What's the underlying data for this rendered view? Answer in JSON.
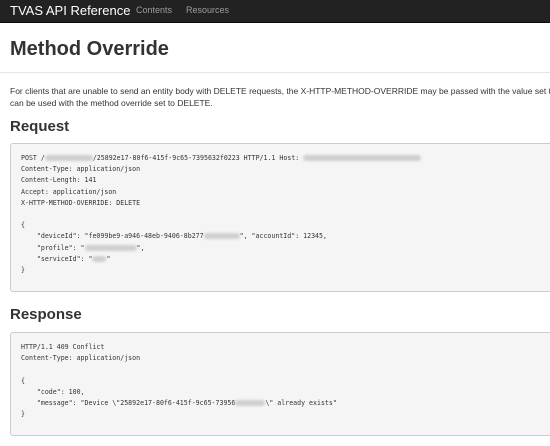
{
  "navbar": {
    "brand": "TVAS API Reference",
    "links": [
      "Contents",
      "Resources"
    ]
  },
  "page": {
    "title": "Method Override",
    "intro_lines": [
      "For clients that are unable to send an entity body with DELETE requests, the X-HTTP-METHOD-OVERRIDE may be passed with the value set to the ve",
      "can be used with the method override set to DELETE."
    ]
  },
  "request": {
    "heading": "Request",
    "lines": [
      {
        "parts": [
          {
            "t": "POST /"
          },
          {
            "blur": 48
          },
          {
            "t": "/25892e17-80f6-415f-9c65-7395632f0223 HTTP/1.1 Host: "
          },
          {
            "blur": 118
          }
        ]
      },
      {
        "parts": [
          {
            "t": "Content-Type: application/json"
          }
        ]
      },
      {
        "parts": [
          {
            "t": "Content-Length: 141"
          }
        ]
      },
      {
        "parts": [
          {
            "t": "Accept: application/json"
          }
        ]
      },
      {
        "parts": [
          {
            "t": "X-HTTP-METHOD-OVERRIDE: DELETE"
          }
        ]
      },
      {
        "parts": [
          {
            "t": ""
          }
        ]
      },
      {
        "parts": [
          {
            "t": "{"
          }
        ]
      },
      {
        "parts": [
          {
            "t": "    \"deviceId\": \"fe099be9-a946-48eb-9406-8b277"
          },
          {
            "blur": 36
          },
          {
            "t": "\", \"accountId\": 12345,"
          }
        ]
      },
      {
        "parts": [
          {
            "t": "    \"profile\": \""
          },
          {
            "blur": 52
          },
          {
            "t": "\","
          }
        ]
      },
      {
        "parts": [
          {
            "t": "    \"serviceId\": \""
          },
          {
            "blur": 14
          },
          {
            "t": "\""
          }
        ]
      },
      {
        "parts": [
          {
            "t": "}"
          }
        ]
      }
    ]
  },
  "response": {
    "heading": "Response",
    "lines": [
      {
        "parts": [
          {
            "t": "HTTP/1.1 409 Conflict"
          }
        ]
      },
      {
        "parts": [
          {
            "t": "Content-Type: application/json"
          }
        ]
      },
      {
        "parts": [
          {
            "t": ""
          }
        ]
      },
      {
        "parts": [
          {
            "t": "{"
          }
        ]
      },
      {
        "parts": [
          {
            "t": "    \"code\": 100,"
          }
        ]
      },
      {
        "parts": [
          {
            "t": "    \"message\": \"Device \\\"25892e17-80f6-415f-9c65-73956"
          },
          {
            "blur": 30
          },
          {
            "t": "\\\" already exists\""
          }
        ]
      },
      {
        "parts": [
          {
            "t": "}"
          }
        ]
      }
    ]
  }
}
